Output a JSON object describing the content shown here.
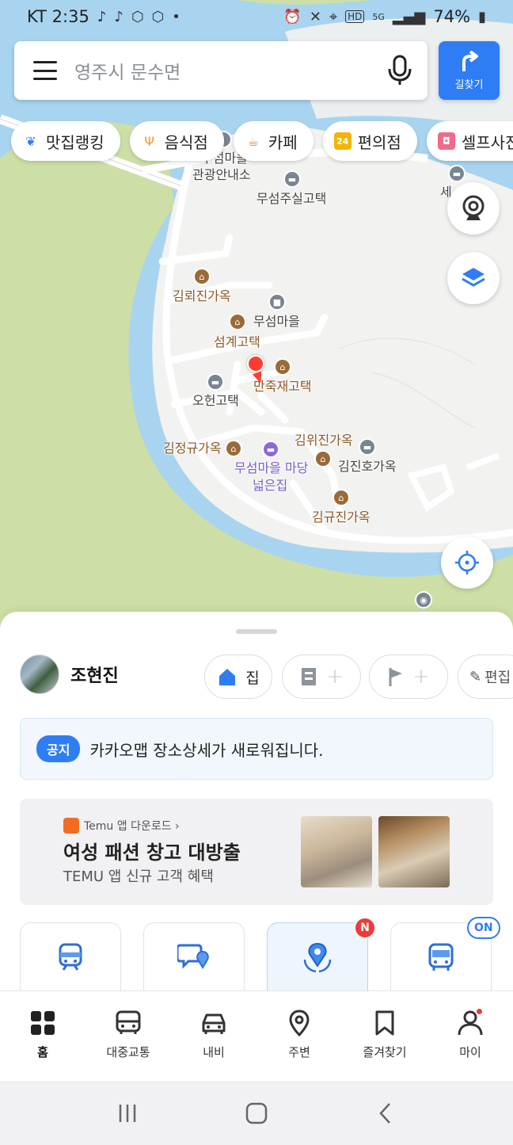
{
  "status_bar": {
    "carrier_time": "KT 2:35",
    "battery": "74%",
    "network": "5G"
  },
  "search": {
    "placeholder": "영주시 문수면",
    "route_label": "길찾기"
  },
  "chips": [
    {
      "label": "맛집랭킹",
      "icon": "pin-laurel-icon",
      "color": "#2f7df5"
    },
    {
      "label": "음식점",
      "icon": "fork-spoon-icon",
      "color": "#f39a1e"
    },
    {
      "label": "카페",
      "icon": "coffee-cup-icon",
      "color": "#f07a2a"
    },
    {
      "label": "편의점",
      "icon": "24-store-icon",
      "color": "#f4b400"
    },
    {
      "label": "셀프사진",
      "icon": "camera-icon",
      "color": "#ef6b8a"
    }
  ],
  "map_labels": {
    "info_center_1": "무섬마을",
    "info_center_2": "관광안내소",
    "musum_jusil": "무섬주실고택",
    "se_partial": "세",
    "gimnoejin": "김뢰진가옥",
    "musum_village": "무섬마을",
    "seomgye": "섬계고택",
    "manjukjae": "만죽재고택",
    "ohyeon": "오헌고택",
    "gimjeonggyu": "김정규가옥",
    "gimwijin": "김위진가옥",
    "gimjinho": "김진호가옥",
    "madang_1": "무섬마을 마당",
    "madang_2": "넓은집",
    "gimgyujin": "김규진가옥"
  },
  "profile": {
    "name": "조현진"
  },
  "favorites": {
    "home_label": "집",
    "edit_label": "편집"
  },
  "notice": {
    "badge": "공지",
    "text": "카카오맵 장소상세가 새로워집니다."
  },
  "ad": {
    "source": "Temu 앱 다운로드 ›",
    "title": "여성 패션 창고 대방출",
    "subtitle": "TEMU 앱 신규 고객 혜택"
  },
  "quick_badges": {
    "new": "N",
    "on": "ON"
  },
  "tabs": [
    {
      "label": "홈",
      "icon": "home-grid-icon",
      "active": true
    },
    {
      "label": "대중교통",
      "icon": "bus-icon",
      "active": false
    },
    {
      "label": "내비",
      "icon": "car-icon",
      "active": false
    },
    {
      "label": "주변",
      "icon": "location-pin-icon",
      "active": false
    },
    {
      "label": "즐겨찾기",
      "icon": "bookmark-icon",
      "active": false
    },
    {
      "label": "마이",
      "icon": "person-icon",
      "active": false
    }
  ],
  "colors": {
    "accent": "#2f7df5",
    "water": "#a8d4f0",
    "land": "#cddfa6",
    "island": "#f2f2f0",
    "marker": "#ff3b30"
  }
}
